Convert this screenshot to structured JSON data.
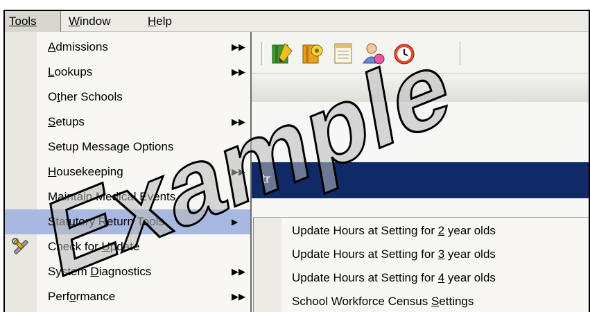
{
  "menubar": {
    "items": [
      {
        "label": "Tools"
      },
      {
        "pre": "",
        "key": "W",
        "post": "indow"
      },
      {
        "pre": "",
        "key": "H",
        "post": "elp"
      }
    ]
  },
  "menu": {
    "items": [
      {
        "pre": "",
        "key": "A",
        "post": "dmissions",
        "submenu": true
      },
      {
        "pre": "",
        "key": "L",
        "post": "ookups",
        "submenu": true
      },
      {
        "pre": "O",
        "key": "t",
        "post": "her Schools",
        "submenu": false
      },
      {
        "pre": "",
        "key": "S",
        "post": "etups",
        "submenu": true
      },
      {
        "pre": "Setup Message Options",
        "key": "",
        "post": "",
        "submenu": false
      },
      {
        "pre": "",
        "key": "H",
        "post": "ousekeeping",
        "submenu": true
      },
      {
        "pre": "Maintain Medical Events",
        "key": "",
        "post": "",
        "submenu": false
      },
      {
        "pre": "Statutory Return Tools",
        "key": "",
        "post": "",
        "submenu": true,
        "highlighted": true
      },
      {
        "pre": "Check for ",
        "key": "U",
        "post": "pdate",
        "submenu": false,
        "icon": "tools-icon"
      },
      {
        "pre": "System ",
        "key": "D",
        "post": "iagnostics",
        "submenu": true
      },
      {
        "pre": "Perf",
        "key": "o",
        "post": "rmance",
        "submenu": true
      }
    ],
    "submenu_arrow": "▶▶"
  },
  "submenu": {
    "items": [
      {
        "pre": "Update Hours at Setting for ",
        "key": "2",
        "post": " year olds"
      },
      {
        "pre": "Update Hours at Setting for ",
        "key": "3",
        "post": " year olds"
      },
      {
        "pre": "Update Hours at Setting for ",
        "key": "4",
        "post": " year olds"
      },
      {
        "pre": "School Workforce Census ",
        "key": "S",
        "post": "ettings"
      }
    ]
  },
  "background": {
    "band_text": "tr"
  },
  "watermark": {
    "text": "Example"
  },
  "icons": {
    "toolbar": [
      "pencil-book-icon",
      "gear-book-icon",
      "notepad-icon",
      "user-group-icon",
      "clock-icon"
    ],
    "menu": [
      "tools-icon"
    ]
  },
  "colors": {
    "highlight": "#a7b9e0",
    "blue_band": "#0f2a66",
    "watermark_fill": "#b9b9b9"
  }
}
